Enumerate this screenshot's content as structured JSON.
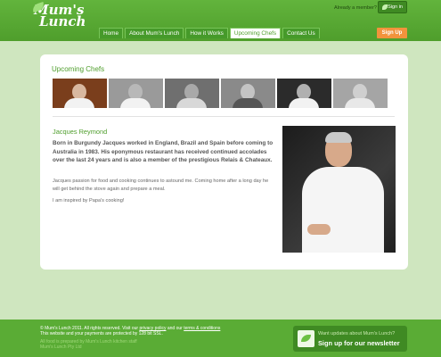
{
  "header": {
    "logo_line1": "Mum's",
    "logo_line2": "Lunch",
    "already_member": "Already a member?",
    "sign_in": "Sign in",
    "sign_up": "Sign Up",
    "nav": [
      {
        "label": "Home"
      },
      {
        "label": "About Mum's Lunch"
      },
      {
        "label": "How it Works"
      },
      {
        "label": "Upcoming Chefs",
        "active": true
      },
      {
        "label": "Contact Us"
      }
    ]
  },
  "main": {
    "section_title": "Upcoming Chefs",
    "chef_name": "Jacques Reymond",
    "bio_bold": "Born in Burgundy Jacques worked in England, Brazil and Spain before coming to Australia in 1983. His eponymous restaurant has received continued accolades over the last 24 years and is also a member of the prestigious Relais & Chateaux.",
    "bio_paragraph": "Jacques passion for food and cooking continues to astound me. Coming home after a long day he will get behind the stove again and prepare a meal.",
    "bio_quote": "I am inspired by Papa's cooking!"
  },
  "footer": {
    "copyright": "© Mum's Lunch 2011. All rights reserved. Visit our",
    "privacy_link": "privacy policy",
    "and_our": "and our",
    "terms_link": "terms & conditions",
    "secure": "This website and your payments are protected by 128 bit SSL.",
    "muted_line1": "All food is prepared by Mum's Lunch kitchen staff",
    "muted_line2": "Mum's Lunch Pty Ltd",
    "newsletter_small": "Want updates about Mum's Lunch?",
    "newsletter_big": "Sign up for our newsletter"
  },
  "colors": {
    "brand_green": "#4f9e2c",
    "accent_orange": "#f2933c",
    "background": "#cfe6bf"
  }
}
